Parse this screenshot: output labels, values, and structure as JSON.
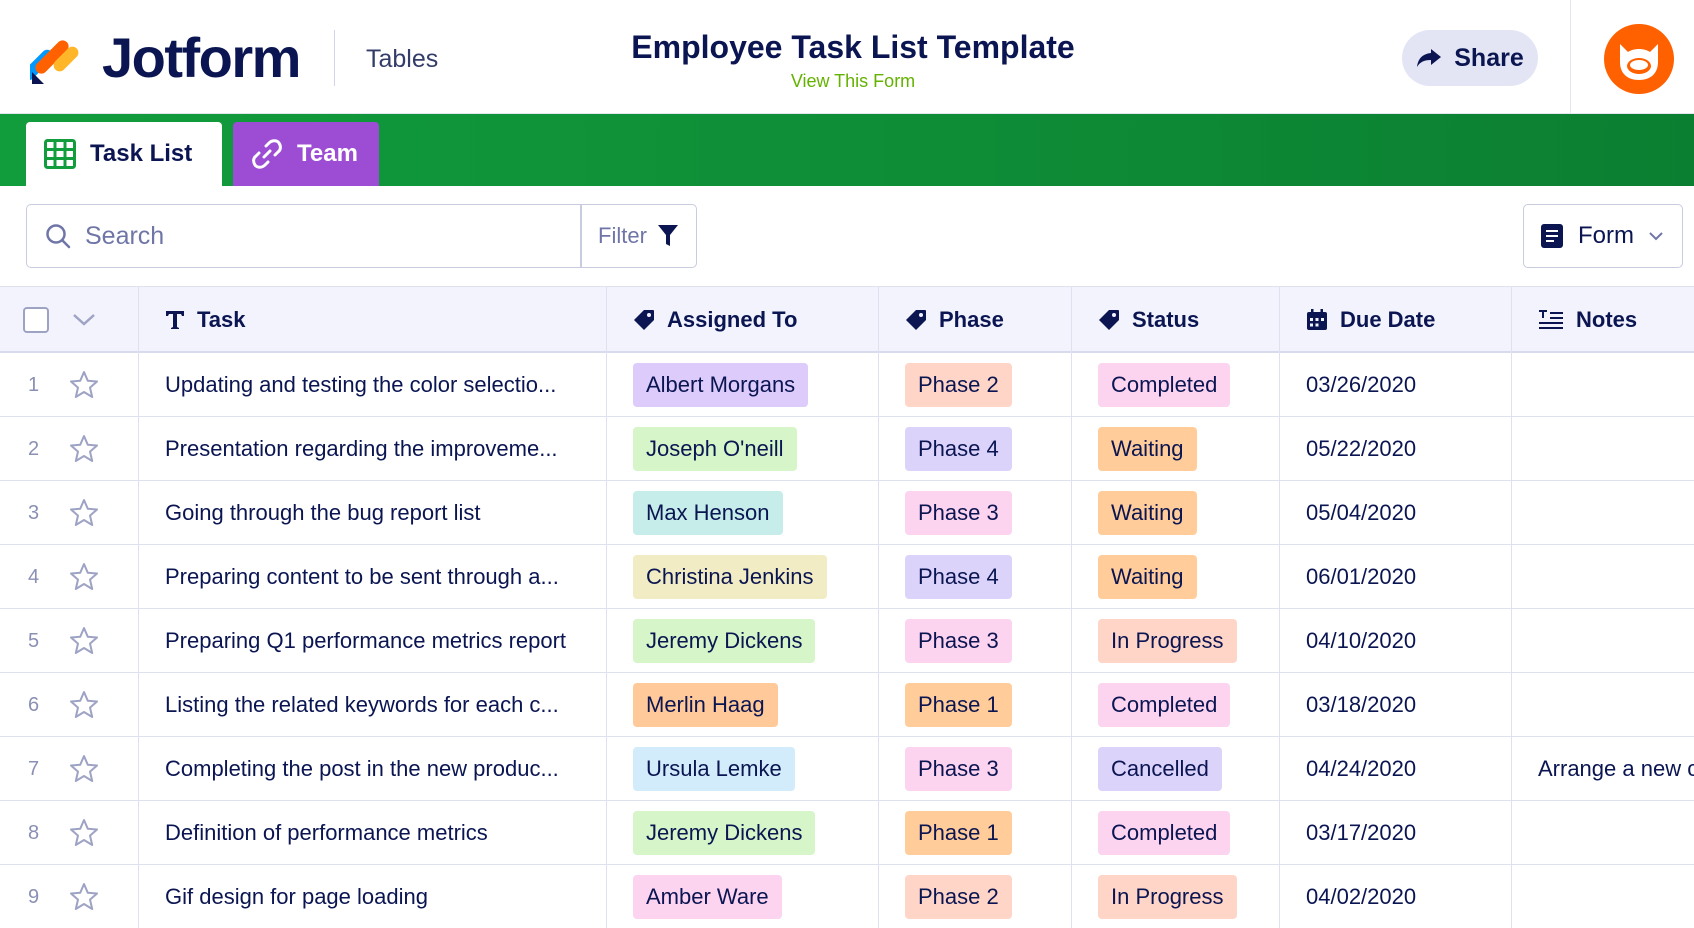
{
  "header": {
    "brand": "Jotform",
    "section": "Tables",
    "title": "Employee Task List Template",
    "subtitle": "View This Form",
    "share_label": "Share"
  },
  "tabs": [
    {
      "label": "Task List",
      "icon": "table-grid-icon",
      "active": true
    },
    {
      "label": "Team",
      "icon": "link-icon",
      "active": false
    }
  ],
  "toolbar": {
    "search_placeholder": "Search",
    "filter_label": "Filter",
    "form_label": "Form"
  },
  "columns": {
    "task": "Task",
    "assigned": "Assigned To",
    "phase": "Phase",
    "status": "Status",
    "due": "Due Date",
    "notes": "Notes"
  },
  "colors": {
    "brand_navy": "#0a1551",
    "tab_green": "#129d3d",
    "team_purple": "#9c4dd3",
    "link_green": "#64b200",
    "avatar_orange": "#ff6100"
  },
  "rows": [
    {
      "num": "1",
      "task": "Updating and testing the color selectio...",
      "assigned": "Albert Morgans",
      "assigned_color": "#dccbfb",
      "phase": "Phase 2",
      "phase_color": "#ffd5c8",
      "status": "Completed",
      "status_color": "#fcd4ef",
      "due": "03/26/2020",
      "notes": ""
    },
    {
      "num": "2",
      "task": "Presentation regarding the improveme...",
      "assigned": "Joseph O'neill",
      "assigned_color": "#d6f5c8",
      "phase": "Phase 4",
      "phase_color": "#dcd3fb",
      "status": "Waiting",
      "status_color": "#ffcc9a",
      "due": "05/22/2020",
      "notes": ""
    },
    {
      "num": "3",
      "task": "Going through the bug report list",
      "assigned": "Max Henson",
      "assigned_color": "#c6ede9",
      "phase": "Phase 3",
      "phase_color": "#fcd4ef",
      "status": "Waiting",
      "status_color": "#ffcc9a",
      "due": "05/04/2020",
      "notes": ""
    },
    {
      "num": "4",
      "task": "Preparing content to be sent through a...",
      "assigned": "Christina Jenkins",
      "assigned_color": "#f2ecc4",
      "phase": "Phase 4",
      "phase_color": "#dcd3fb",
      "status": "Waiting",
      "status_color": "#ffcc9a",
      "due": "06/01/2020",
      "notes": ""
    },
    {
      "num": "5",
      "task": "Preparing Q1 performance metrics report",
      "assigned": "Jeremy Dickens",
      "assigned_color": "#d6f5c8",
      "phase": "Phase 3",
      "phase_color": "#fcd4ef",
      "status": "In Progress",
      "status_color": "#ffd5c8",
      "due": "04/10/2020",
      "notes": ""
    },
    {
      "num": "6",
      "task": "Listing the related keywords for each c...",
      "assigned": "Merlin Haag",
      "assigned_color": "#ffc99a",
      "phase": "Phase 1",
      "phase_color": "#ffcc9a",
      "status": "Completed",
      "status_color": "#fcd4ef",
      "due": "03/18/2020",
      "notes": ""
    },
    {
      "num": "7",
      "task": "Completing the post in the new produc...",
      "assigned": "Ursula Lemke",
      "assigned_color": "#d3ecfb",
      "phase": "Phase 3",
      "phase_color": "#fcd4ef",
      "status": "Cancelled",
      "status_color": "#dcd3fb",
      "due": "04/24/2020",
      "notes": "Arrange a new c"
    },
    {
      "num": "8",
      "task": "Definition of performance metrics",
      "assigned": "Jeremy Dickens",
      "assigned_color": "#d6f5c8",
      "phase": "Phase 1",
      "phase_color": "#ffcc9a",
      "status": "Completed",
      "status_color": "#fcd4ef",
      "due": "03/17/2020",
      "notes": ""
    },
    {
      "num": "9",
      "task": "Gif design for page loading",
      "assigned": "Amber Ware",
      "assigned_color": "#fcd4ef",
      "phase": "Phase 2",
      "phase_color": "#ffd5c8",
      "status": "In Progress",
      "status_color": "#ffd5c8",
      "due": "04/02/2020",
      "notes": ""
    }
  ]
}
